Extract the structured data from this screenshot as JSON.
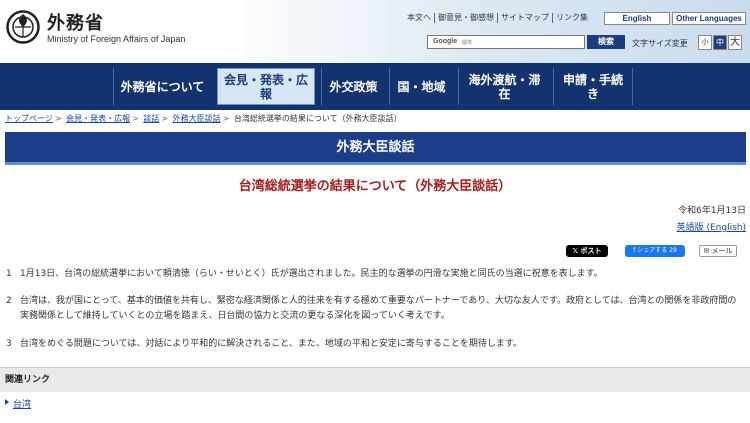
{
  "header": {
    "title": "外務省",
    "subtitle": "Ministry of Foreign Affairs of Japan",
    "util_links": [
      "本文へ",
      "御意見・御感想",
      "サイトマップ",
      "リンク集"
    ],
    "lang_english": "English",
    "lang_other": "Other Languages",
    "search_brand": "Google",
    "search_placeholder": "提供",
    "search_button": "検索",
    "fontsize_label": "文字サイズ変更",
    "fontsize_small": "小",
    "fontsize_mid": "中",
    "fontsize_large": "大"
  },
  "nav": {
    "items": [
      {
        "label": "外務省について"
      },
      {
        "label": "会見・発表・広報"
      },
      {
        "label": "外交政策"
      },
      {
        "label": "国・地域"
      },
      {
        "label": "海外渡航・滞在"
      },
      {
        "label": "申請・手続き"
      }
    ]
  },
  "breadcrumb": {
    "items": [
      "トップページ",
      "会見・発表・広報",
      "談話",
      "外務大臣談話"
    ],
    "current": "台湾総統選挙の結果について（外務大臣談話）"
  },
  "section_title": "外務大臣談話",
  "page_title": "台湾総統選挙の結果について（外務大臣談話）",
  "date": "令和6年1月13日",
  "english_link": "英語版 (English)",
  "share": {
    "x": "𝕏 ポスト",
    "facebook": "f シェアする 29",
    "mail": "✉ メール"
  },
  "paragraphs": [
    {
      "num": "1",
      "text": "1月13日、台湾の総統選挙において頼清徳（らい・せいとく）氏が選出されました。民主的な選挙の円滑な実施と同氏の当選に祝意を表します。"
    },
    {
      "num": "2",
      "text": "台湾は、我が国にとって、基本的価値を共有し、緊密な経済関係と人的往来を有する極めて重要なパートナーであり、大切な友人です。政府としては、台湾との関係を非政府間の実務関係として維持していくとの立場を踏まえ、日台間の協力と交流の更なる深化を図っていく考えです。"
    },
    {
      "num": "3",
      "text": "台湾をめぐる問題については、対話により平和的に解決されること、また、地域の平和と安定に寄与することを期待します。"
    }
  ],
  "related": {
    "heading": "関連リンク",
    "links": [
      "台湾"
    ]
  },
  "colors": {
    "nav_bg": "#12336e",
    "section_bg": "#1c3d8a",
    "title_red": "#a51e1e",
    "link_blue": "#1a44a5"
  }
}
